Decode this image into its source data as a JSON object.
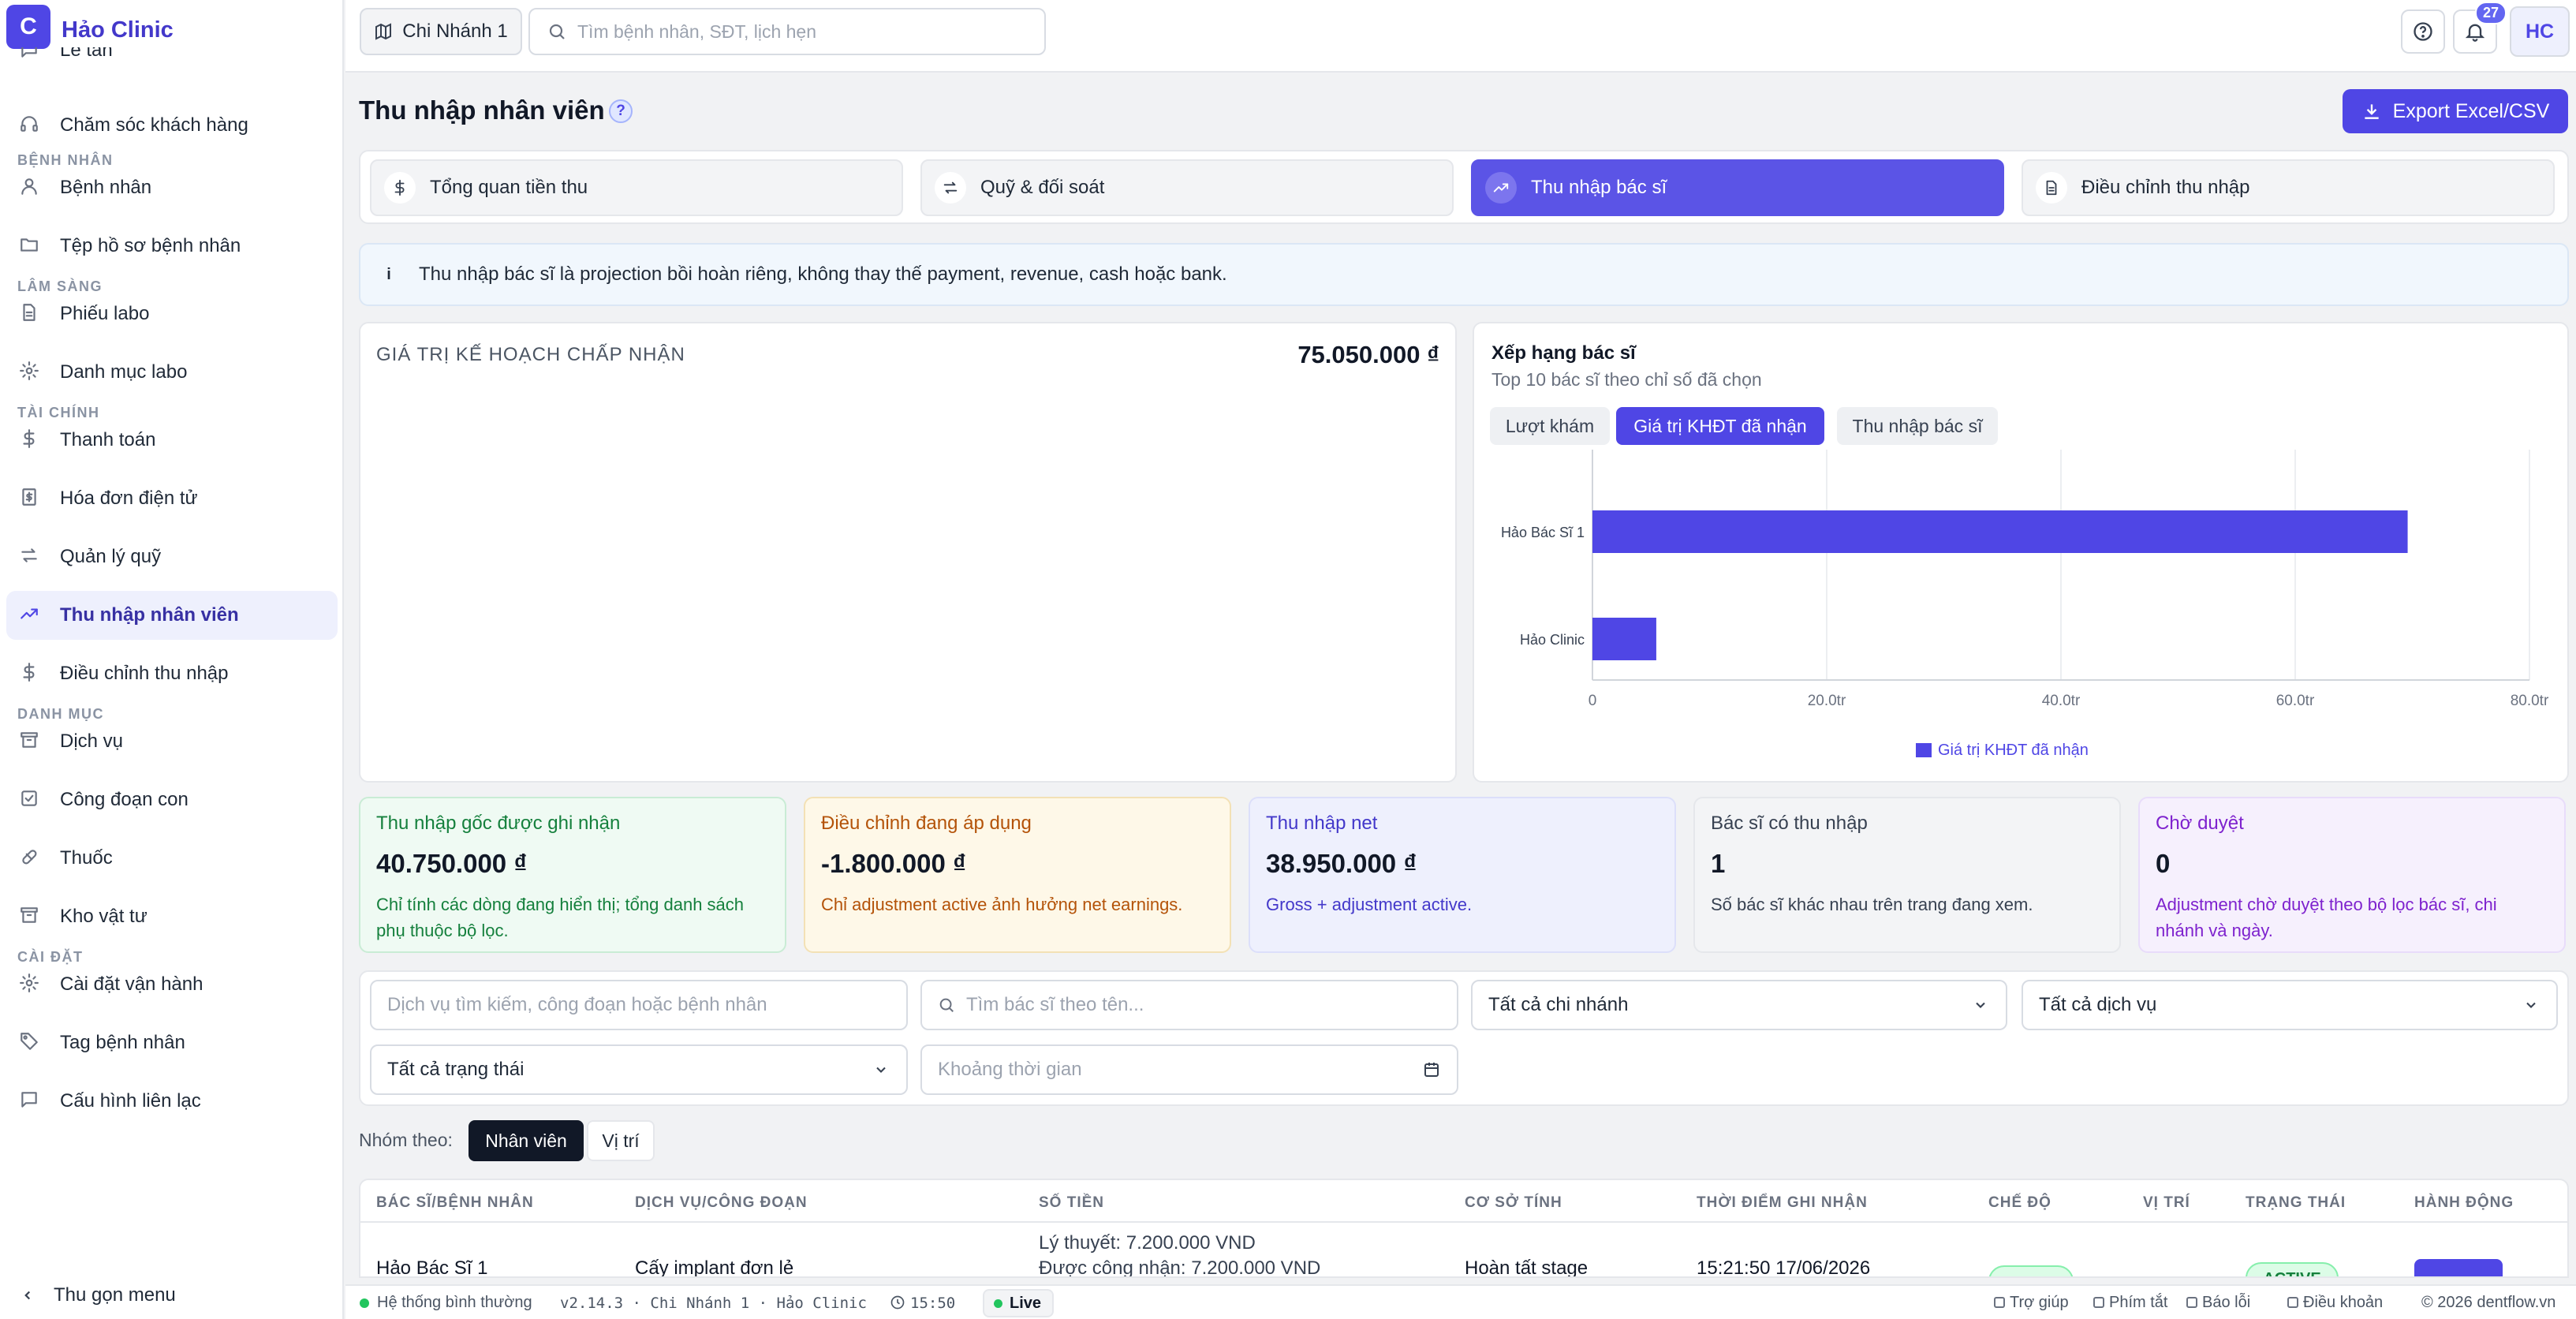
{
  "app": {
    "logo_letter": "C",
    "brand": "Hảo Clinic"
  },
  "sidebar": {
    "partial_top": "Lễ tân",
    "items_top": [
      {
        "label": "Chăm sóc khách hàng",
        "icon": "headset-icon"
      }
    ],
    "sections": [
      {
        "label": "BỆNH NHÂN",
        "items": [
          {
            "label": "Bệnh nhân",
            "icon": "user-icon"
          },
          {
            "label": "Tệp hồ sơ bệnh nhân",
            "icon": "folder-icon"
          }
        ]
      },
      {
        "label": "LÂM SÀNG",
        "items": [
          {
            "label": "Phiếu labo",
            "icon": "file-icon"
          },
          {
            "label": "Danh mục labo",
            "icon": "gear-icon"
          }
        ]
      },
      {
        "label": "TÀI CHÍNH",
        "items": [
          {
            "label": "Thanh toán",
            "icon": "dollar-icon"
          },
          {
            "label": "Hóa đơn điện tử",
            "icon": "invoice-icon"
          },
          {
            "label": "Quản lý quỹ",
            "icon": "transfer-icon"
          },
          {
            "label": "Thu nhập nhân viên",
            "icon": "trending-up-icon",
            "active": true
          },
          {
            "label": "Điều chỉnh thu nhập",
            "icon": "dollar-icon"
          }
        ]
      },
      {
        "label": "DANH MỤC",
        "items": [
          {
            "label": "Dịch vụ",
            "icon": "archive-icon"
          },
          {
            "label": "Công đoạn con",
            "icon": "checkbox-icon"
          },
          {
            "label": "Thuốc",
            "icon": "pill-icon"
          },
          {
            "label": "Kho vật tư",
            "icon": "archive-icon"
          }
        ]
      },
      {
        "label": "CÀI ĐẶT",
        "items": [
          {
            "label": "Cài đặt vận hành",
            "icon": "gear-icon"
          },
          {
            "label": "Tag bệnh nhân",
            "icon": "tag-icon"
          },
          {
            "label": "Cấu hình liên lạc",
            "icon": "message-icon"
          }
        ]
      }
    ],
    "collapse_label": "Thu gọn menu"
  },
  "topbar": {
    "branch": "Chi Nhánh 1",
    "search_placeholder": "Tìm bệnh nhân, SĐT, lịch hẹn",
    "notifications": "27",
    "avatar": "HC"
  },
  "page": {
    "title": "Thu nhập nhân viên",
    "help": "?",
    "export_label": "Export Excel/CSV",
    "tabs": [
      {
        "label": "Tổng quan tiền thu",
        "icon": "dollar-icon"
      },
      {
        "label": "Quỹ & đối soát",
        "icon": "transfer-icon"
      },
      {
        "label": "Thu nhập bác sĩ",
        "icon": "trending-up-icon",
        "active": true
      },
      {
        "label": "Điều chỉnh thu nhập",
        "icon": "file-icon"
      }
    ],
    "info_icon": "i",
    "info_text": "Thu nhập bác sĩ là projection bồi hoàn riêng, không thay thế payment, revenue, cash hoặc bank."
  },
  "plan_card": {
    "label": "GIÁ TRỊ KẾ HOẠCH CHẤP NHẬN",
    "value": "75.050.000 ₫"
  },
  "ranking": {
    "title": "Xếp hạng bác sĩ",
    "subtitle": "Top 10 bác sĩ theo chỉ số đã chọn",
    "metrics": [
      "Lượt khám",
      "Giá trị KHĐT đã nhận",
      "Thu nhập bác sĩ"
    ],
    "active_metric": 1
  },
  "chart_data": {
    "type": "bar",
    "orientation": "horizontal",
    "categories": [
      "Hảo Bác Sĩ 1",
      "Hảo Clinic"
    ],
    "series": [
      {
        "name": "Giá trị KHĐT đã nhận",
        "values": [
          69600000,
          5450000
        ]
      }
    ],
    "xlim": [
      0,
      80000000
    ],
    "ticks": [
      0,
      20000000,
      40000000,
      60000000,
      80000000
    ],
    "tick_labels": [
      "0",
      "20.0tr",
      "40.0tr",
      "60.0tr",
      "80.0tr"
    ],
    "grid": true,
    "legend": "bottom",
    "color": "#4f46e5"
  },
  "stats": [
    {
      "title": "Thu nhập gốc được ghi nhận",
      "value": "40.750.000 ₫",
      "desc": "Chỉ tính các dòng đang hiển thị; tổng danh sách phụ thuộc bộ lọc.",
      "bg": "#effaf3",
      "border": "#c9ecd5",
      "color": "#15803d"
    },
    {
      "title": "Điều chỉnh đang áp dụng",
      "value": "-1.800.000 ₫",
      "desc": "Chỉ adjustment active ảnh hưởng net earnings.",
      "bg": "#fef8e8",
      "border": "#f3e1b5",
      "color": "#b45309"
    },
    {
      "title": "Thu nhập net",
      "value": "38.950.000 ₫",
      "desc": "Gross + adjustment active.",
      "bg": "#eef0fd",
      "border": "#dcdffa",
      "color": "#4338ca"
    },
    {
      "title": "Bác sĩ có thu nhập",
      "value": "1",
      "desc": "Số bác sĩ khác nhau trên trang đang xem.",
      "bg": "#f3f4f6",
      "border": "#e5e7eb",
      "color": "#374151"
    },
    {
      "title": "Chờ duyệt",
      "value": "0",
      "desc": "Adjustment chờ duyệt theo bộ lọc bác sĩ, chi nhánh và ngày.",
      "bg": "#f6f0fd",
      "border": "#e8dcfa",
      "color": "#7e22ce"
    }
  ],
  "filters": {
    "service_search_placeholder": "Dịch vụ tìm kiếm, công đoạn hoặc bệnh nhân",
    "doctor_search_placeholder": "Tìm bác sĩ theo tên...",
    "branch": "Tất cả chi nhánh",
    "service": "Tất cả dịch vụ",
    "status": "Tất cả trạng thái",
    "date_placeholder": "Khoảng thời gian"
  },
  "grouping": {
    "label": "Nhóm theo:",
    "options": [
      "Nhân viên",
      "Vị trí"
    ],
    "active": 0
  },
  "table": {
    "headers": [
      "BÁC SĨ/BỆNH NHÂN",
      "DỊCH VỤ/CÔNG ĐOẠN",
      "SỐ TIỀN",
      "CƠ SỞ TÍNH",
      "THỜI ĐIỂM GHI NHẬN",
      "CHẾ ĐỘ",
      "VỊ TRÍ",
      "TRẠNG THÁI",
      "HÀNH ĐỘNG"
    ],
    "row": {
      "doctor": "Hảo Bác Sĩ 1",
      "service": "Cấy implant đơn lẻ",
      "amount_theory": "Lý thuyết: 7.200.000 VND",
      "amount_recognized": "Được công nhận: 7.200.000 VND",
      "basis": "Hoàn tất stage",
      "time": "15:21:50 17/06/2026",
      "status": "ACTIVE"
    }
  },
  "statusbar": {
    "system": "Hệ thống bình thường",
    "version": "v2.14.3 · Chi Nhánh 1 · Hảo Clinic",
    "clock": "15:50",
    "live": "Live",
    "links": [
      "Trợ giúp",
      "Phím tắt",
      "Báo lỗi",
      "Điều khoản"
    ],
    "copyright": "© 2026 dentflow.vn"
  }
}
